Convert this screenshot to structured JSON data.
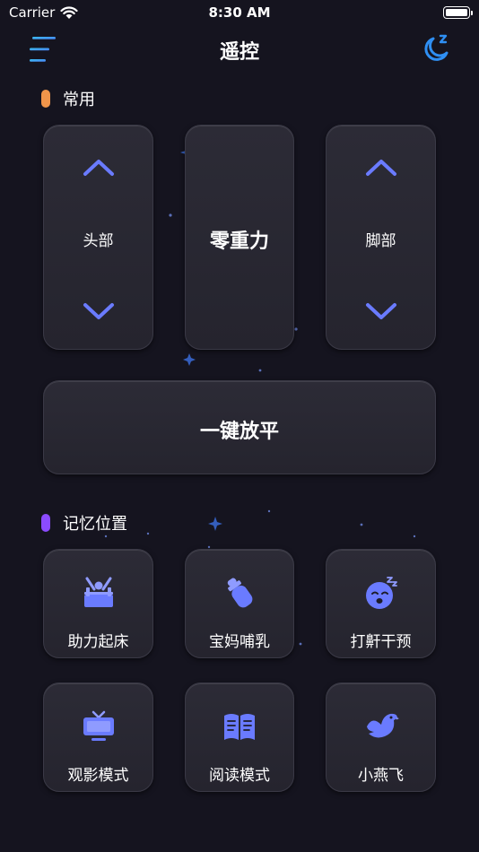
{
  "status_bar": {
    "carrier": "Carrier",
    "time": "8:30 AM"
  },
  "nav": {
    "title": "遥控",
    "menu_icon": "menu-icon",
    "mode_icon": "moon-sleep-icon"
  },
  "common": {
    "title": "常用",
    "accent": "#f0954a",
    "head": {
      "label": "头部",
      "up_icon": "chevron-up-icon",
      "down_icon": "chevron-down-icon"
    },
    "zero_gravity": {
      "label": "零重力"
    },
    "foot": {
      "label": "脚部",
      "up_icon": "chevron-up-icon",
      "down_icon": "chevron-down-icon"
    },
    "flat": {
      "label": "一键放平"
    }
  },
  "memory": {
    "title": "记忆位置",
    "accent": "#8b4bff",
    "icon_color": "#6a7bff",
    "items": [
      {
        "label": "助力起床",
        "icon": "wake-up-bed-icon"
      },
      {
        "label": "宝妈哺乳",
        "icon": "baby-bottle-icon"
      },
      {
        "label": "打鼾干预",
        "icon": "snoring-face-icon"
      },
      {
        "label": "观影模式",
        "icon": "tv-icon"
      },
      {
        "label": "阅读模式",
        "icon": "open-book-icon"
      },
      {
        "label": "小燕飞",
        "icon": "bird-icon"
      }
    ]
  }
}
